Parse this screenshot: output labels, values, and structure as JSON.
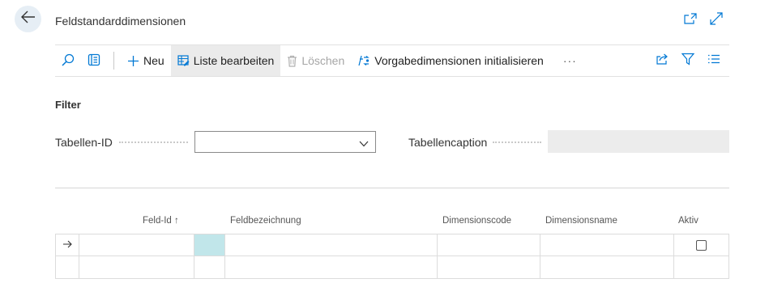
{
  "page": {
    "title": "Feldstandarddimensionen"
  },
  "toolbar": {
    "new_label": "Neu",
    "edit_list_label": "Liste bearbeiten",
    "delete_label": "Löschen",
    "init_label": "Vorgabedimensionen initialisieren",
    "more_label": "···"
  },
  "filter": {
    "heading": "Filter",
    "table_id_label": "Tabellen-ID",
    "table_id_value": "",
    "table_caption_label": "Tabellencaption",
    "table_caption_value": ""
  },
  "table": {
    "columns": [
      "Feld-Id",
      "Feldbezeichnung",
      "Dimensionscode",
      "Dimensionsname",
      "Aktiv"
    ],
    "sort_indicator": "↑",
    "row_marker": "→"
  },
  "colors": {
    "accent": "#0078d4",
    "selected_cell": "#c1e6ea"
  }
}
